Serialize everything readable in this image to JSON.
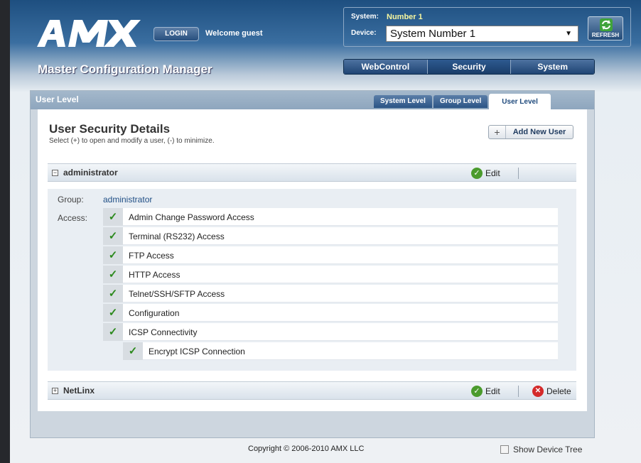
{
  "header": {
    "logo_text": "AMX",
    "login_label": "LOGIN",
    "welcome_text": "Welcome guest",
    "system_label": "System:",
    "system_value": "Number 1",
    "device_label": "Device:",
    "device_selected": "System Number 1",
    "refresh_label": "REFRESH",
    "page_title": "Master Configuration Manager",
    "main_tabs": [
      {
        "label": "WebControl",
        "active": false
      },
      {
        "label": "Security",
        "active": true
      },
      {
        "label": "System",
        "active": false
      }
    ]
  },
  "panel": {
    "title": "User Level",
    "sub_tabs": [
      {
        "label": "System Level",
        "active": false
      },
      {
        "label": "Group Level",
        "active": false
      },
      {
        "label": "User Level",
        "active": true
      }
    ],
    "section_title": "User Security Details",
    "section_subtitle": "Select (+) to open and modify a user, (-) to minimize.",
    "add_user_label": "Add New User",
    "add_user_icon": "+"
  },
  "users": [
    {
      "name": "administrator",
      "expanded": true,
      "toggle": "−",
      "edit_label": "Edit",
      "group_label": "Group:",
      "group_value": "administrator",
      "access_label": "Access:",
      "access": [
        {
          "label": "Admin Change Password Access",
          "checked": true
        },
        {
          "label": "Terminal (RS232) Access",
          "checked": true
        },
        {
          "label": "FTP Access",
          "checked": true
        },
        {
          "label": "HTTP Access",
          "checked": true
        },
        {
          "label": "Telnet/SSH/SFTP Access",
          "checked": true
        },
        {
          "label": "Configuration",
          "checked": true
        },
        {
          "label": "ICSP Connectivity",
          "checked": true
        },
        {
          "label": "Encrypt ICSP Connection",
          "checked": true
        }
      ]
    },
    {
      "name": "NetLinx",
      "expanded": false,
      "toggle": "+",
      "edit_label": "Edit",
      "delete_label": "Delete"
    }
  ],
  "footer": {
    "copyright": "Copyright © 2006-2010 AMX LLC",
    "show_device_tree": "Show Device Tree"
  },
  "colors": {
    "header_blue": "#1e4f80",
    "check_green": "#2d8a1e",
    "delete_red": "#d42a2a",
    "link_blue": "#1f4e85"
  }
}
